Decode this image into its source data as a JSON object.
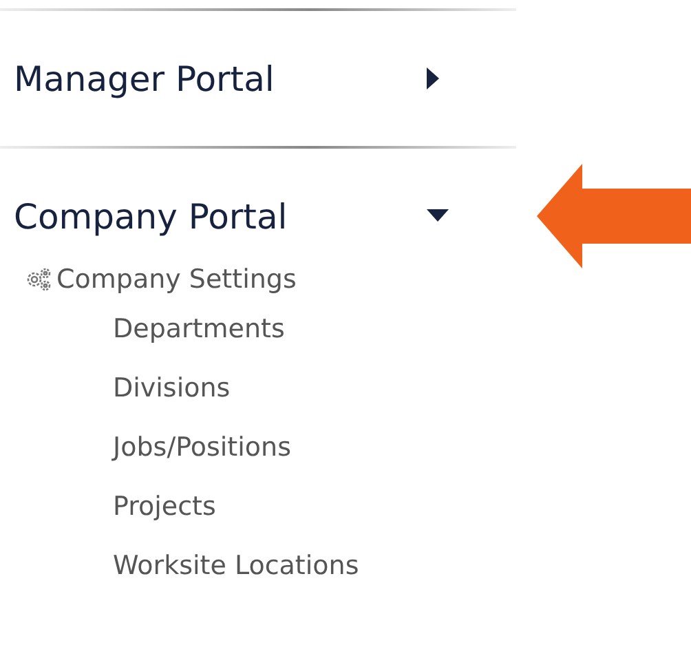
{
  "portals": [
    {
      "label": "Manager Portal",
      "expanded": false,
      "annotated": false
    },
    {
      "label": "Company Portal",
      "expanded": true,
      "annotated": true,
      "sections": [
        {
          "label": "Company Settings",
          "items": [
            "Departments",
            "Divisions",
            "Jobs/Positions",
            "Projects",
            "Worksite Locations"
          ]
        }
      ]
    }
  ]
}
